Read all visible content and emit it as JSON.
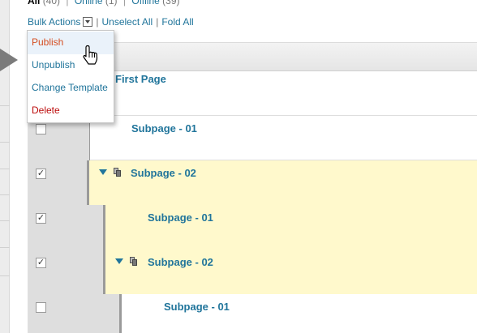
{
  "filters": {
    "all_label": "All",
    "all_count": "(40)",
    "online_label": "Online",
    "online_count": "(1)",
    "offline_label": "Offline",
    "offline_count": "(39)"
  },
  "toolbar": {
    "bulk_actions_label": "Bulk Actions",
    "unselect_all_label": "Unselect All",
    "fold_all_label": "Fold All"
  },
  "bulk_menu": {
    "items": [
      {
        "label": "Publish"
      },
      {
        "label": "Unpublish"
      },
      {
        "label": "Change Template"
      },
      {
        "label": "Delete"
      }
    ]
  },
  "tree": {
    "rows": [
      {
        "title": "First Page",
        "checked": false
      },
      {
        "title": "Subpage - 01",
        "checked": false
      },
      {
        "title": "Subpage - 02",
        "checked": true
      },
      {
        "title": "Subpage - 01",
        "checked": true
      },
      {
        "title": "Subpage - 02",
        "checked": true
      },
      {
        "title": "Subpage - 01",
        "checked": false
      }
    ]
  },
  "colors": {
    "link": "#21759b",
    "selected_row": "#fff9cc",
    "active_menu_text": "#d54e21",
    "delete_text": "#bc0b0b"
  },
  "icons": [
    "chevron-down-icon",
    "fold-arrow-icon",
    "page-copy-icon",
    "hand-cursor-icon"
  ]
}
